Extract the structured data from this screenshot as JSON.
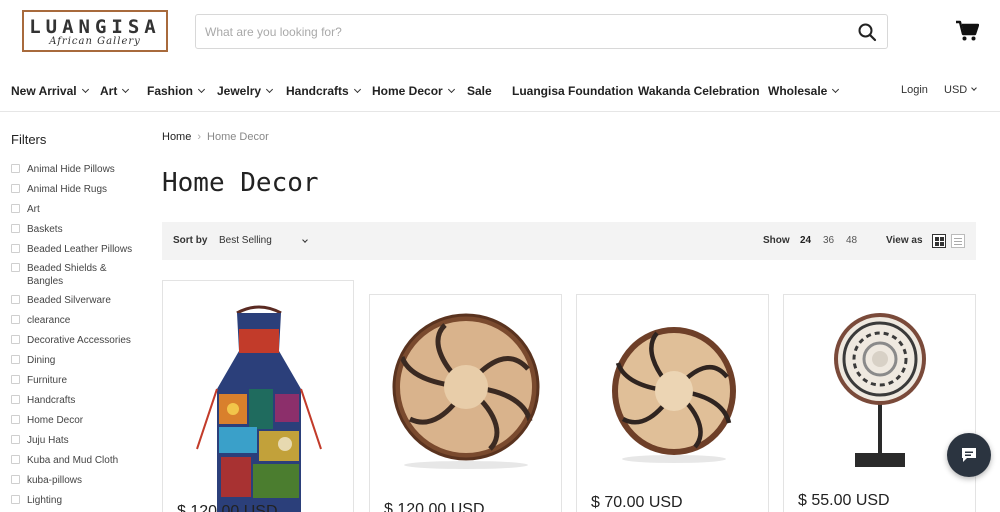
{
  "header": {
    "logo_main": "LUANGISA",
    "logo_sub": "African Gallery",
    "search_placeholder": "What are you looking for?"
  },
  "nav": {
    "items": [
      {
        "label": "New Arrival",
        "dropdown": true
      },
      {
        "label": "Art",
        "dropdown": true
      },
      {
        "label": "Fashion",
        "dropdown": true
      },
      {
        "label": "Jewelry",
        "dropdown": true
      },
      {
        "label": "Handcrafts",
        "dropdown": true
      },
      {
        "label": "Home Decor",
        "dropdown": true
      },
      {
        "label": "Sale",
        "dropdown": false
      },
      {
        "label": "Luangisa Foundation",
        "dropdown": false
      },
      {
        "label": "Wakanda Celebration",
        "dropdown": false
      },
      {
        "label": "Wholesale",
        "dropdown": true
      }
    ],
    "login": "Login",
    "currency": "USD"
  },
  "sidebar": {
    "title": "Filters",
    "filters": [
      "Animal Hide Pillows",
      "Animal Hide Rugs",
      "Art",
      "Baskets",
      "Beaded Leather Pillows",
      "Beaded Shields & Bangles",
      "Beaded Silverware",
      "clearance",
      "Decorative Accessories",
      "Dining",
      "Furniture",
      "Handcrafts",
      "Home Decor",
      "Juju Hats",
      "Kuba and Mud Cloth",
      "kuba-pillows",
      "Lighting"
    ]
  },
  "main": {
    "breadcrumb": {
      "home": "Home",
      "current": "Home Decor"
    },
    "title": "Home Decor",
    "sort_label": "Sort by",
    "sort_value": "Best Selling",
    "show_label": "Show",
    "show_options": [
      "24",
      "36",
      "48"
    ],
    "show_active": "24",
    "view_label": "View as"
  },
  "products": [
    {
      "name": "patchwork-apron",
      "price": "$ 120.00 USD"
    },
    {
      "name": "woven-basket-large",
      "price": "$ 120.00 USD"
    },
    {
      "name": "woven-basket-medium",
      "price": "$ 70.00 USD"
    },
    {
      "name": "basket-on-stand",
      "price": "$ 55.00 USD"
    }
  ],
  "colors": {
    "logo_border": "#a86a3c",
    "sortbar_bg": "#f3f3f3",
    "chat_bg": "#2b3440",
    "text": "#222222"
  },
  "icons": {
    "search": "search-icon",
    "cart": "cart-icon",
    "grid_view": "grid-view-icon",
    "list_view": "list-view-icon",
    "chat": "chat-icon"
  }
}
